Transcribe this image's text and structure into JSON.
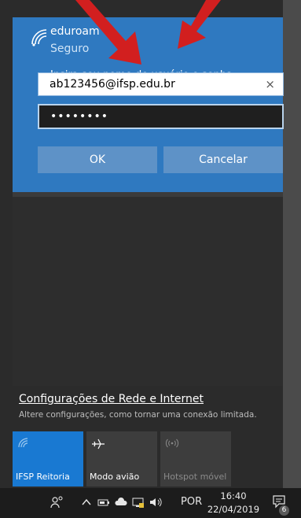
{
  "network": {
    "name": "eduroam",
    "status": "Seguro",
    "prompt": "Insira seu nome de usuário e senha",
    "username_value": "ab123456@ifsp.edu.br",
    "clear_icon": "×",
    "password_mask": "••••••••",
    "ok_label": "OK",
    "cancel_label": "Cancelar"
  },
  "settings": {
    "link_text": "Configurações de Rede e Internet",
    "description": "Altere configurações, como tornar uma conexão limitada."
  },
  "quick_actions": [
    {
      "label": "IFSP Reitoria",
      "icon": "wifi-icon",
      "active": true
    },
    {
      "label": "Modo avião",
      "icon": "airplane-icon",
      "active": false
    },
    {
      "label": "Hotspot móvel",
      "icon": "hotspot-icon",
      "active": false
    }
  ],
  "taskbar": {
    "language": "POR",
    "time": "16:40",
    "date": "22/04/2019",
    "notification_count": "6"
  },
  "colors": {
    "accent": "#2f79c0",
    "tile_active": "#1979d2",
    "annotation_arrow": "#d21f1f"
  }
}
